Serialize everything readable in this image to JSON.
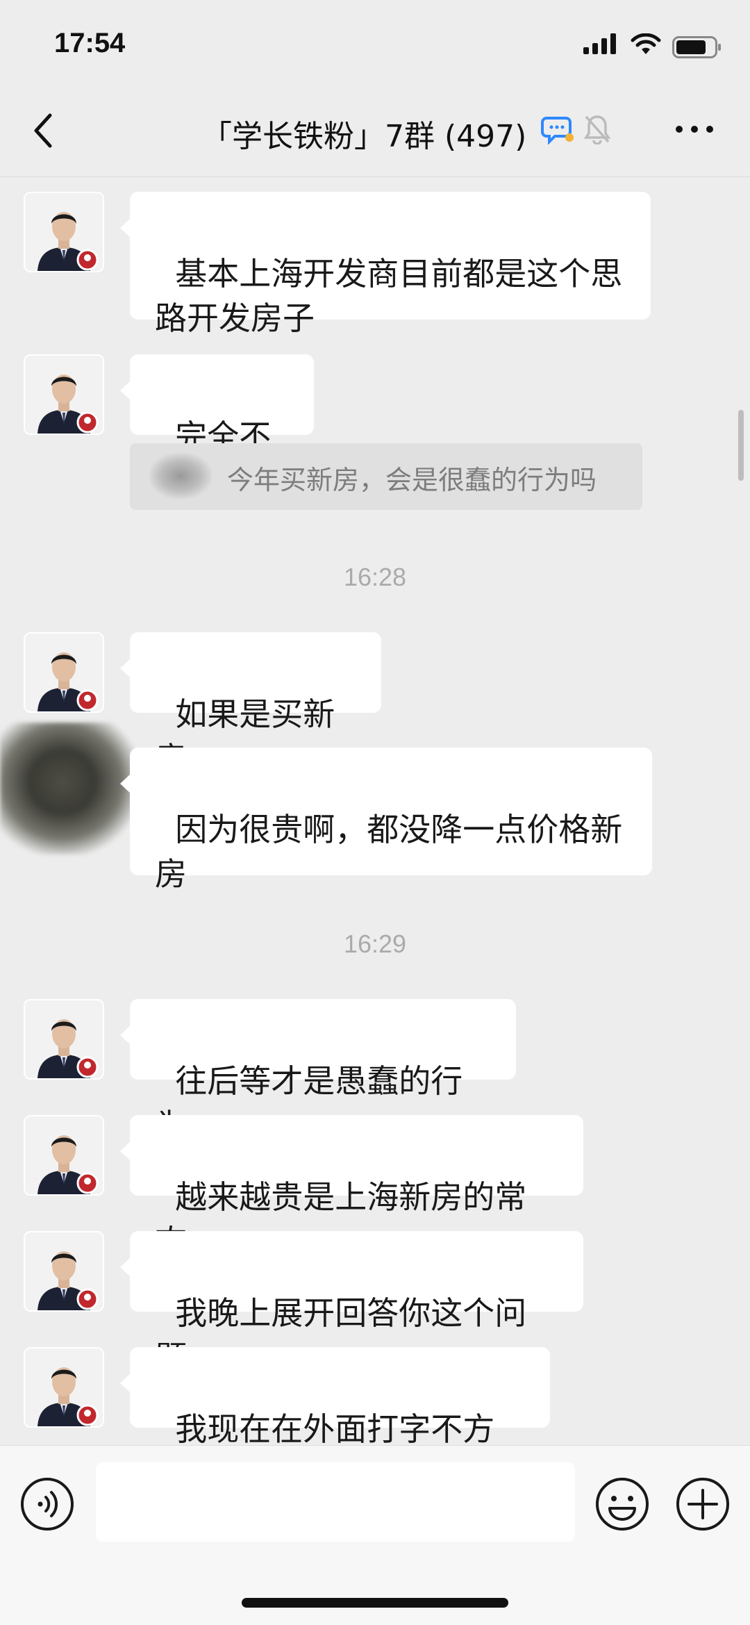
{
  "status_bar": {
    "time": "17:54"
  },
  "header": {
    "title": "「学长铁粉」7群 (497)"
  },
  "messages": [
    {
      "text": "基本上海开发商目前都是这个思\n路开发房子"
    },
    {
      "text": "完全不会"
    },
    {
      "text": "如果是买新房"
    },
    {
      "text": "因为很贵啊，都没降一点价格新\n房"
    },
    {
      "text": "往后等才是愚蠢的行为"
    },
    {
      "text": "越来越贵是上海新房的常态"
    },
    {
      "text": "我晚上展开回答你这个问题"
    },
    {
      "text": "我现在在外面打字不方便"
    }
  ],
  "quote": {
    "text": "今年买新房，会是很蠢的行为吗"
  },
  "timestamps": [
    "16:28",
    "16:29"
  ],
  "input": {
    "value": ""
  },
  "colors": {
    "background": "#ededed",
    "bubble": "#ffffff",
    "chat_icon_blue": "#2f88ff"
  }
}
